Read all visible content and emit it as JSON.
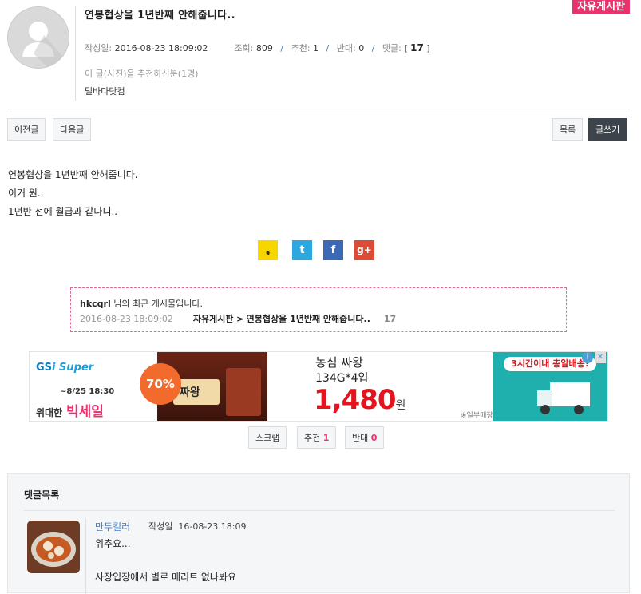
{
  "post": {
    "board_badge": "자유게시판",
    "title": "연봉협상을 1년반째 안해줍니다..",
    "meta": {
      "date_label": "작성일:",
      "date": "2016-08-23 18:09:02",
      "views_label": "조회:",
      "views": "809",
      "recommend_label": "추천:",
      "recommend": "1",
      "oppose_label": "반대:",
      "oppose": "0",
      "comments_label": "댓글:",
      "comments_open": "[",
      "comments": "17",
      "comments_close": "]",
      "sep": "/"
    },
    "recommenders_title": "이 글(사진)을 추천하신분(1명)",
    "recommenders": "덜바다닷컴",
    "body_lines": [
      "연봉협상을 1년반째 안해줍니다.",
      "이거 원..",
      "1년반 전에 월급과 같다니.."
    ]
  },
  "nav": {
    "prev": "이전글",
    "next": "다음글",
    "list": "목록",
    "write": "글쓰기"
  },
  "share": {
    "kakao_glyph": "❟",
    "twitter_glyph": "t",
    "facebook_glyph": "f",
    "google_glyph": "g+",
    "colors": {
      "kakao": "#f7d600",
      "twitter": "#2ba8e0",
      "facebook": "#3b69b6",
      "google": "#dc4a38"
    }
  },
  "recent": {
    "user": "hkcqrl",
    "suffix": " 님의 최근 게시물입니다.",
    "date": "2016-08-23 18:09:02",
    "board": "자유게시판",
    "arrow": ">",
    "title": "연봉협상을 1년반째 안해줍니다..",
    "count": "17"
  },
  "ad": {
    "brand": "GS",
    "brand2": "i Super",
    "date": "~8/25 18:30",
    "sale1": "위대한",
    "sale2": "빅세일",
    "discount": "70%",
    "product_pkg": "짜왕",
    "product_name": "농심 짜왕",
    "product_spec": "134G*4입",
    "price": "1,480",
    "price_unit": "원",
    "note": "※일부매장 제외",
    "delivery": "3시간이내 총알배송!",
    "adchoices": "i",
    "close": "✕"
  },
  "votes": {
    "scrap": "스크랩",
    "recommend_label": "추천",
    "recommend": "1",
    "oppose_label": "반대",
    "oppose": "0"
  },
  "comments": {
    "title": "댓글목록",
    "items": [
      {
        "name": "만두킬러",
        "date_label": "작성일",
        "date": "16-08-23 18:09",
        "line1": "위추요...",
        "line2": "사장입장에서 별로 메리트 없나봐요"
      }
    ]
  }
}
